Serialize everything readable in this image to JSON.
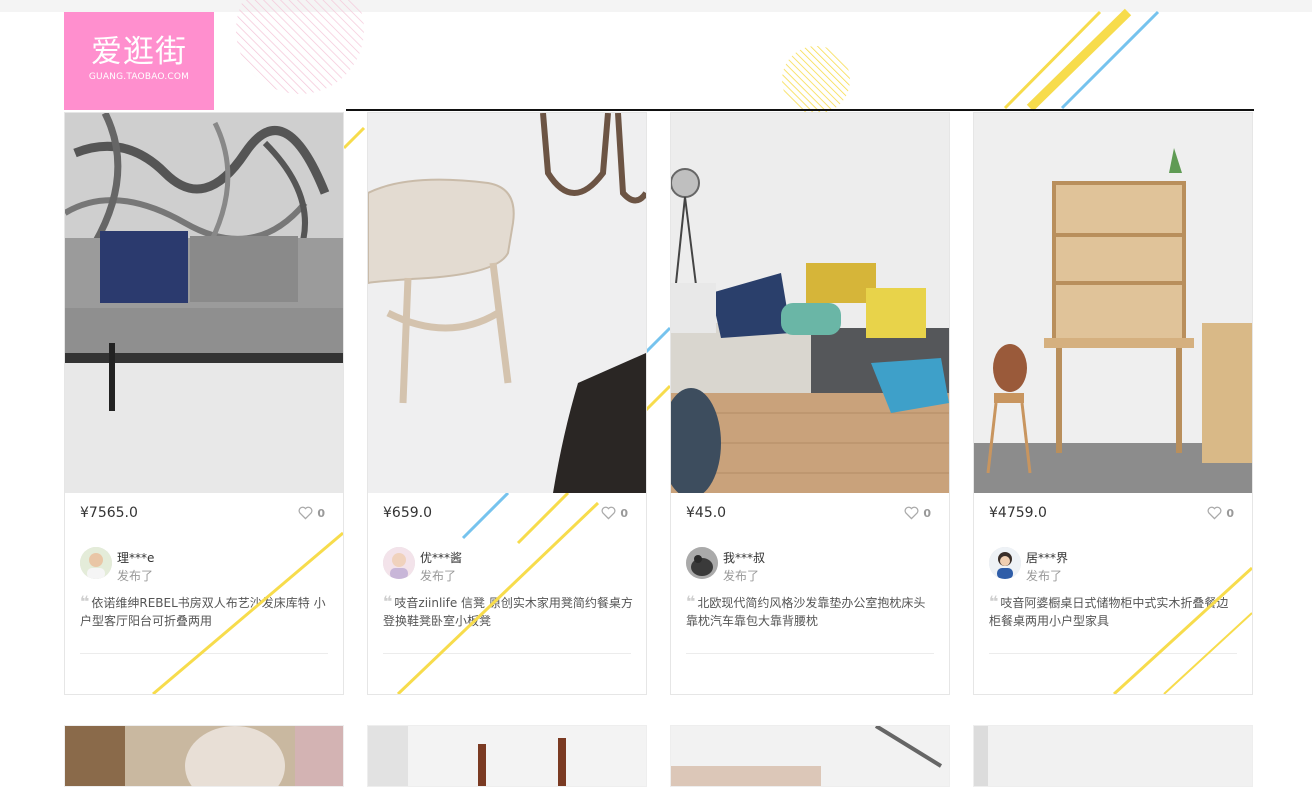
{
  "logo": {
    "text_cn": "爱逛街",
    "text_en": "GUANG.TAOBAO.COM",
    "bg_color": "#ff8fce"
  },
  "colors": {
    "accent_yellow": "#f7dc4c",
    "accent_blue": "#76c3ee",
    "accent_pink": "#f4c6d8"
  },
  "products": [
    {
      "price": "¥7565.0",
      "likes": "0",
      "user": "理***e",
      "user_label": "发布了",
      "description": "依诺维绅REBEL书房双人布艺沙发床库特 小户型客厅阳台可折叠两用",
      "image": "grey-sofa-bed"
    },
    {
      "price": "¥659.0",
      "likes": "0",
      "user": "优***酱",
      "user_label": "发布了",
      "description": "吱音ziinlife 信凳 原创实木家用凳简约餐桌方登换鞋凳卧室小板凳",
      "image": "wooden-stools"
    },
    {
      "price": "¥45.0",
      "likes": "0",
      "user": "我***叔",
      "user_label": "发布了",
      "description": "北欧现代简约风格沙发靠垫办公室抱枕床头靠枕汽车靠包大靠背腰枕",
      "image": "sofa-cushions"
    },
    {
      "price": "¥4759.0",
      "likes": "0",
      "user": "居***界",
      "user_label": "发布了",
      "description": "吱音阿婆橱桌日式储物柜中式实木折叠餐边柜餐桌两用小户型家具",
      "image": "wooden-cabinet-desk"
    }
  ],
  "second_row": [
    {
      "image": "vanity-mirror"
    },
    {
      "image": "coat-rack"
    },
    {
      "image": "floor-lamp"
    },
    {
      "image": "white-room"
    }
  ]
}
